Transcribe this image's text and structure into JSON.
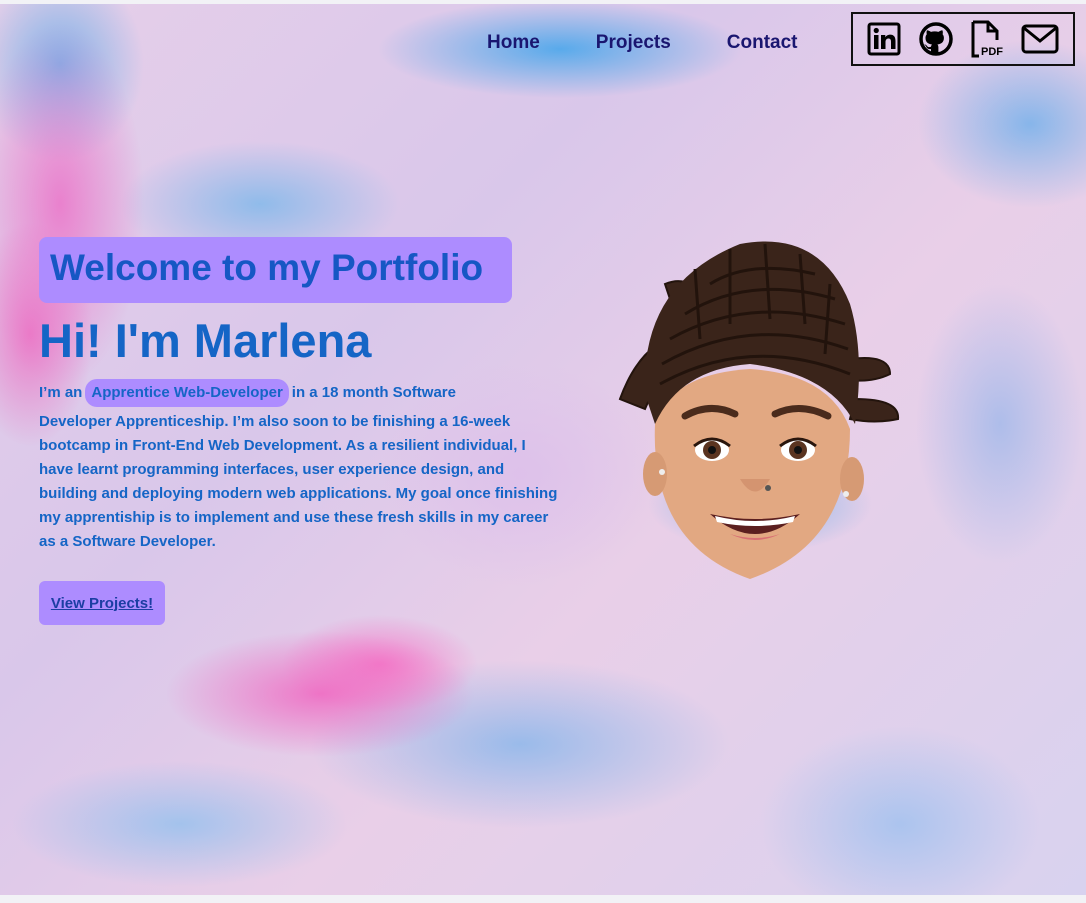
{
  "nav": {
    "items": [
      {
        "label": "Home"
      },
      {
        "label": "Projects"
      },
      {
        "label": "Contact"
      }
    ]
  },
  "social": {
    "icons": [
      "linkedin-icon",
      "github-icon",
      "pdf-icon",
      "mail-icon"
    ]
  },
  "hero": {
    "welcome": "Welcome to my Portfolio",
    "greeting": "Hi! I'm Marlena",
    "bio_prefix": "I’m an",
    "role_chip": "Apprentice Web-Developer",
    "bio_suffix": "in a 18 month Software",
    "bio_body": "Developer Apprenticeship. I’m also soon to be finishing a 16-week bootcamp in Front-End Web Development. As a resilient individual, I have learnt programming interfaces, user experience design, and building and deploying modern web applications. My goal once finishing my apprentiship is to implement and use these fresh skills in my career as a Software Developer.",
    "cta_label": "View Projects!"
  },
  "colors": {
    "accent_purple": "#ad8cff",
    "text_blue": "#1565c6",
    "nav_navy": "#1a1670"
  }
}
